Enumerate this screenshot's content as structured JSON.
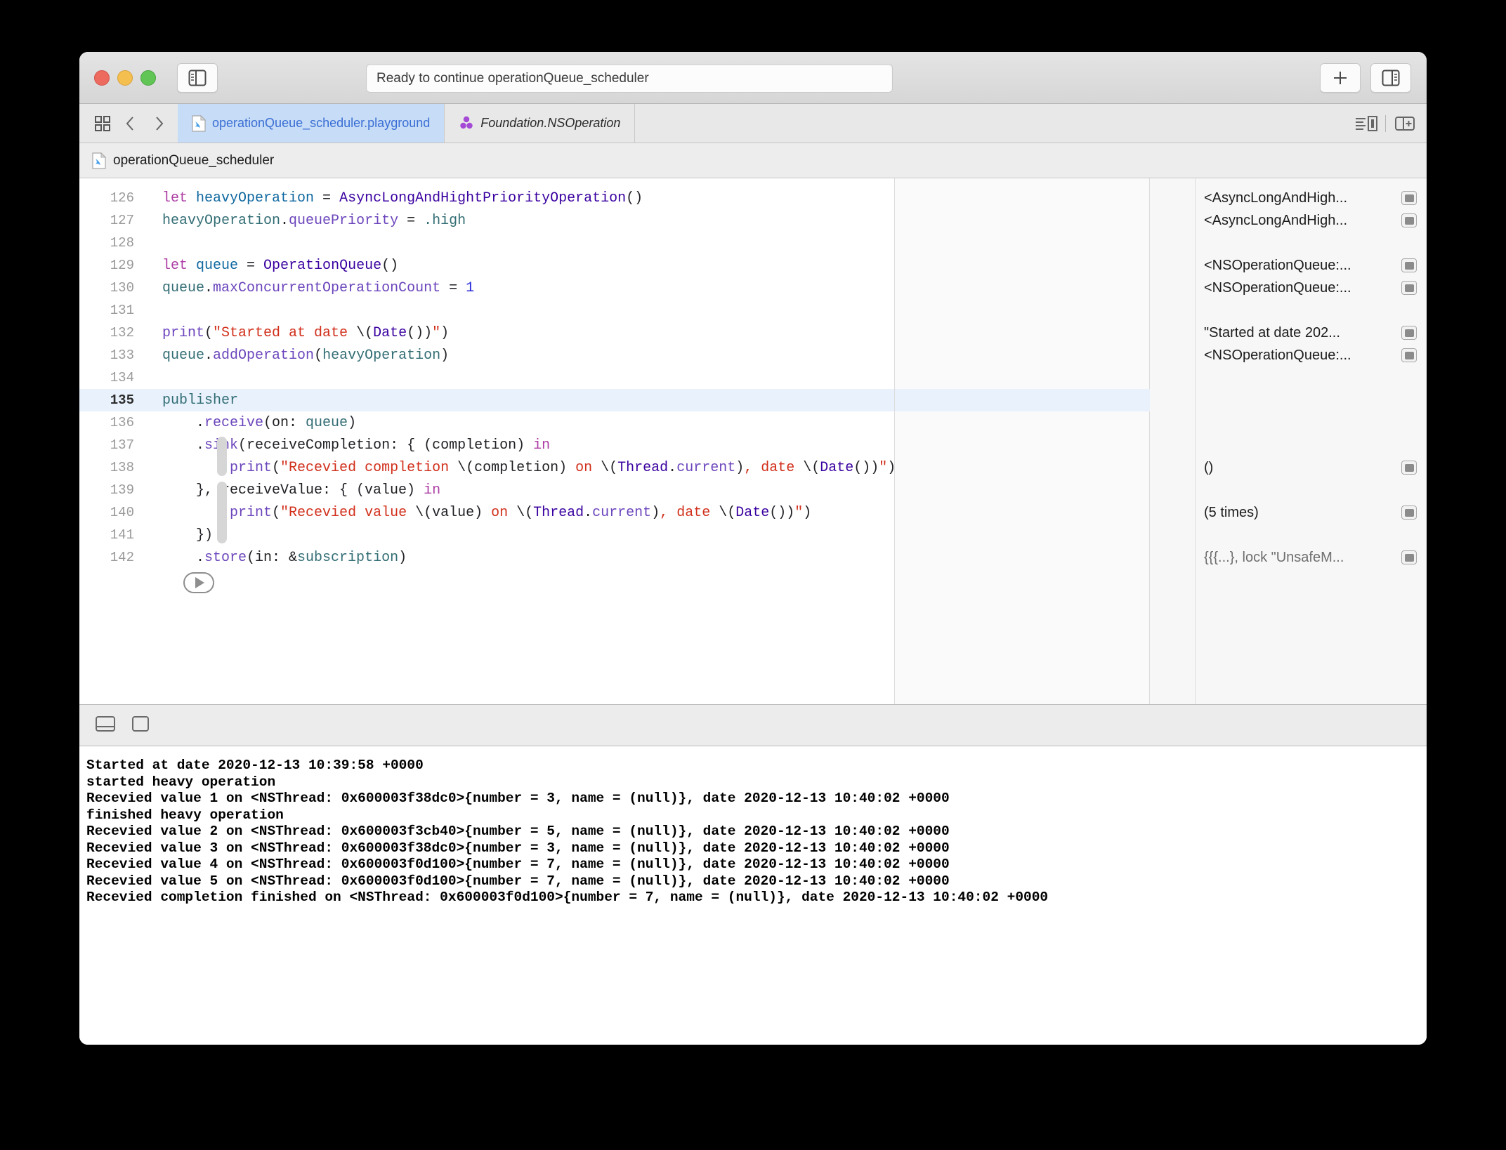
{
  "window": {
    "traffic_lights": [
      "close",
      "minimize",
      "zoom"
    ],
    "status_text": "Ready to continue operationQueue_scheduler",
    "left_sidebar_toggle_icon": "sidebar-left-icon",
    "add_icon": "plus-icon",
    "right_sidebar_toggle_icon": "sidebar-right-icon"
  },
  "tabbar": {
    "grid_icon": "tab-grid-icon",
    "back_icon": "chevron-left-icon",
    "forward_icon": "chevron-right-icon",
    "tabs": [
      {
        "label": "operationQueue_scheduler.playground",
        "icon": "swift-file-icon",
        "active": true
      },
      {
        "label": "Foundation.NSOperation",
        "icon": "framework-icon",
        "active": false
      }
    ],
    "editor_options_icon": "editor-options-icon",
    "add_editor_icon": "add-editor-icon"
  },
  "pathbar": {
    "icon": "swift-file-icon",
    "label": "operationQueue_scheduler"
  },
  "editor": {
    "current_line": 135,
    "run_button_icon": "play-icon",
    "lines": [
      {
        "n": "126",
        "tokens": [
          {
            "t": "let ",
            "c": "kw"
          },
          {
            "t": "heavyOperation",
            "c": "var"
          },
          {
            "t": " = ",
            "c": "pln"
          },
          {
            "t": "AsyncLongAndHightPriorityOperation",
            "c": "typ"
          },
          {
            "t": "()",
            "c": "pln"
          }
        ]
      },
      {
        "n": "127",
        "tokens": [
          {
            "t": "heavyOperation",
            "c": "prop"
          },
          {
            "t": ".",
            "c": "pln"
          },
          {
            "t": "queuePriority",
            "c": "meth"
          },
          {
            "t": " = ",
            "c": "pln"
          },
          {
            "t": ".high",
            "c": "prop"
          }
        ]
      },
      {
        "n": "128",
        "tokens": []
      },
      {
        "n": "129",
        "tokens": [
          {
            "t": "let ",
            "c": "kw"
          },
          {
            "t": "queue",
            "c": "var"
          },
          {
            "t": " = ",
            "c": "pln"
          },
          {
            "t": "OperationQueue",
            "c": "typ"
          },
          {
            "t": "()",
            "c": "pln"
          }
        ]
      },
      {
        "n": "130",
        "tokens": [
          {
            "t": "queue",
            "c": "prop"
          },
          {
            "t": ".",
            "c": "pln"
          },
          {
            "t": "maxConcurrentOperationCount",
            "c": "meth"
          },
          {
            "t": " = ",
            "c": "pln"
          },
          {
            "t": "1",
            "c": "num"
          }
        ]
      },
      {
        "n": "131",
        "tokens": []
      },
      {
        "n": "132",
        "tokens": [
          {
            "t": "print",
            "c": "meth"
          },
          {
            "t": "(",
            "c": "pln"
          },
          {
            "t": "\"Started at date ",
            "c": "str"
          },
          {
            "t": "\\(",
            "c": "pln"
          },
          {
            "t": "Date",
            "c": "typ"
          },
          {
            "t": "())",
            "c": "pln"
          },
          {
            "t": "\"",
            "c": "str"
          },
          {
            "t": ")",
            "c": "pln"
          }
        ]
      },
      {
        "n": "133",
        "tokens": [
          {
            "t": "queue",
            "c": "prop"
          },
          {
            "t": ".",
            "c": "pln"
          },
          {
            "t": "addOperation",
            "c": "meth"
          },
          {
            "t": "(",
            "c": "pln"
          },
          {
            "t": "heavyOperation",
            "c": "prop"
          },
          {
            "t": ")",
            "c": "pln"
          }
        ]
      },
      {
        "n": "134",
        "tokens": []
      },
      {
        "n": "135",
        "tokens": [
          {
            "t": "publisher",
            "c": "prop"
          }
        ]
      },
      {
        "n": "136",
        "tokens": [
          {
            "t": "    .",
            "c": "pln"
          },
          {
            "t": "receive",
            "c": "meth"
          },
          {
            "t": "(on: ",
            "c": "pln"
          },
          {
            "t": "queue",
            "c": "prop"
          },
          {
            "t": ")",
            "c": "pln"
          }
        ]
      },
      {
        "n": "137",
        "tokens": [
          {
            "t": "    .",
            "c": "pln"
          },
          {
            "t": "sink",
            "c": "meth"
          },
          {
            "t": "(receiveCompletion: { (completion) ",
            "c": "pln"
          },
          {
            "t": "in",
            "c": "kw"
          }
        ]
      },
      {
        "n": "138",
        "tokens": [
          {
            "t": "        ",
            "c": "pln"
          },
          {
            "t": "print",
            "c": "meth"
          },
          {
            "t": "(",
            "c": "pln"
          },
          {
            "t": "\"Recevied completion ",
            "c": "str"
          },
          {
            "t": "\\(completion) ",
            "c": "pln"
          },
          {
            "t": "on ",
            "c": "str"
          },
          {
            "t": "\\(",
            "c": "pln"
          },
          {
            "t": "Thread",
            "c": "typ"
          },
          {
            "t": ".",
            "c": "pln"
          },
          {
            "t": "current",
            "c": "meth"
          },
          {
            "t": ")",
            "c": "pln"
          },
          {
            "t": ", date ",
            "c": "str"
          },
          {
            "t": "\\(",
            "c": "pln"
          },
          {
            "t": "Date",
            "c": "typ"
          },
          {
            "t": "())",
            "c": "pln"
          },
          {
            "t": "\"",
            "c": "str"
          },
          {
            "t": ")",
            "c": "pln"
          }
        ]
      },
      {
        "n": "139",
        "tokens": [
          {
            "t": "    }, receiveValue: { (value) ",
            "c": "pln"
          },
          {
            "t": "in",
            "c": "kw"
          }
        ]
      },
      {
        "n": "140",
        "tokens": [
          {
            "t": "        ",
            "c": "pln"
          },
          {
            "t": "print",
            "c": "meth"
          },
          {
            "t": "(",
            "c": "pln"
          },
          {
            "t": "\"Recevied value ",
            "c": "str"
          },
          {
            "t": "\\(value) ",
            "c": "pln"
          },
          {
            "t": "on ",
            "c": "str"
          },
          {
            "t": "\\(",
            "c": "pln"
          },
          {
            "t": "Thread",
            "c": "typ"
          },
          {
            "t": ".",
            "c": "pln"
          },
          {
            "t": "current",
            "c": "meth"
          },
          {
            "t": ")",
            "c": "pln"
          },
          {
            "t": ", date ",
            "c": "str"
          },
          {
            "t": "\\(",
            "c": "pln"
          },
          {
            "t": "Date",
            "c": "typ"
          },
          {
            "t": "())",
            "c": "pln"
          },
          {
            "t": "\"",
            "c": "str"
          },
          {
            "t": ")",
            "c": "pln"
          }
        ]
      },
      {
        "n": "141",
        "tokens": [
          {
            "t": "    })",
            "c": "pln"
          }
        ]
      },
      {
        "n": "142",
        "tokens": [
          {
            "t": "    .",
            "c": "pln"
          },
          {
            "t": "store",
            "c": "meth"
          },
          {
            "t": "(in: &",
            "c": "pln"
          },
          {
            "t": "subscription",
            "c": "prop"
          },
          {
            "t": ")",
            "c": "pln"
          }
        ]
      }
    ]
  },
  "results": [
    {
      "line": 0,
      "text": "<AsyncLongAndHigh...",
      "dim": false
    },
    {
      "line": 1,
      "text": "<AsyncLongAndHigh...",
      "dim": false
    },
    {
      "line": 3,
      "text": "<NSOperationQueue:...",
      "dim": false
    },
    {
      "line": 4,
      "text": "<NSOperationQueue:...",
      "dim": false
    },
    {
      "line": 6,
      "text": "\"Started at date 202...",
      "dim": false
    },
    {
      "line": 7,
      "text": "<NSOperationQueue:...",
      "dim": false
    },
    {
      "line": 12,
      "text": "()",
      "dim": false
    },
    {
      "line": 14,
      "text": "(5 times)",
      "dim": false
    },
    {
      "line": 16,
      "text": "{{{...}, lock \"UnsafeM...",
      "dim": true
    }
  ],
  "debugbar": {
    "toggle_console_icon": "toggle-console-icon",
    "toggle_variables_icon": "toggle-variables-icon"
  },
  "console": {
    "lines": [
      "Started at date 2020-12-13 10:39:58 +0000",
      "started heavy operation",
      "Recevied value 1 on <NSThread: 0x600003f38dc0>{number = 3, name = (null)}, date 2020-12-13 10:40:02 +0000",
      "finished heavy operation",
      "Recevied value 2 on <NSThread: 0x600003f3cb40>{number = 5, name = (null)}, date 2020-12-13 10:40:02 +0000",
      "Recevied value 3 on <NSThread: 0x600003f38dc0>{number = 3, name = (null)}, date 2020-12-13 10:40:02 +0000",
      "Recevied value 4 on <NSThread: 0x600003f0d100>{number = 7, name = (null)}, date 2020-12-13 10:40:02 +0000",
      "Recevied value 5 on <NSThread: 0x600003f0d100>{number = 7, name = (null)}, date 2020-12-13 10:40:02 +0000",
      "Recevied completion finished on <NSThread: 0x600003f0d100>{number = 7, name = (null)}, date 2020-12-13 10:40:02 +0000"
    ]
  },
  "colors": {
    "tab_active_bg": "#c6dcf7",
    "tab_active_fg": "#3b6fd4",
    "current_line_bg": "#e8f1fc"
  }
}
